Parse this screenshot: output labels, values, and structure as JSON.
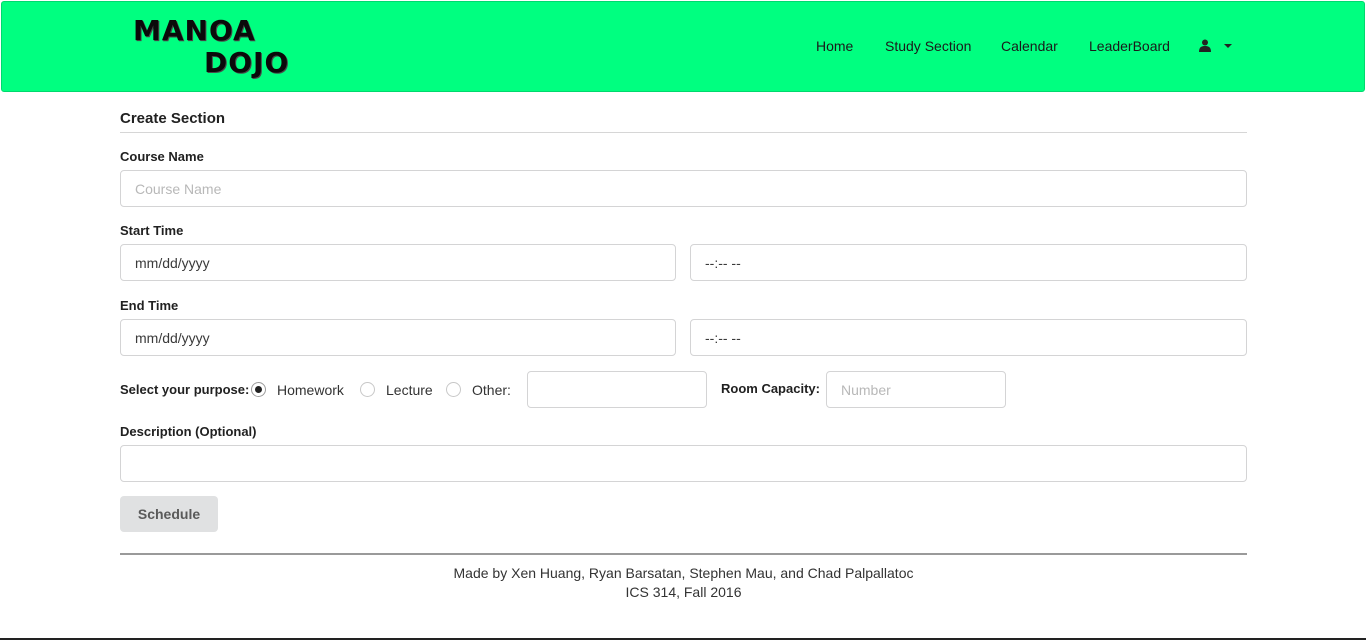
{
  "header": {
    "logo_line1": "MANOA",
    "logo_line2": "DOJO",
    "nav": [
      "Home",
      "Study Section",
      "Calendar",
      "LeaderBoard"
    ],
    "user_icon": "user-icon",
    "bg_color": "#00ff80"
  },
  "form": {
    "title": "Create Section",
    "course_name": {
      "label": "Course Name",
      "placeholder": "Course Name",
      "value": ""
    },
    "start_time": {
      "label": "Start Time",
      "date": "mm/dd/yyyy",
      "time": "--:-- --"
    },
    "end_time": {
      "label": "End Time",
      "date": "mm/dd/yyyy",
      "time": "--:-- --"
    },
    "purpose": {
      "label": "Select your purpose:",
      "options": [
        "Homework",
        "Lecture",
        "Other:"
      ],
      "selected": "Homework",
      "other_value": ""
    },
    "capacity": {
      "label": "Room Capacity:",
      "placeholder": "Number"
    },
    "description": {
      "label": "Description (Optional)",
      "value": ""
    },
    "submit_label": "Schedule"
  },
  "footer": {
    "credits": "Made by Xen Huang, Ryan Barsatan, Stephen Mau, and Chad Palpallatoc",
    "course": "ICS 314, Fall 2016"
  }
}
